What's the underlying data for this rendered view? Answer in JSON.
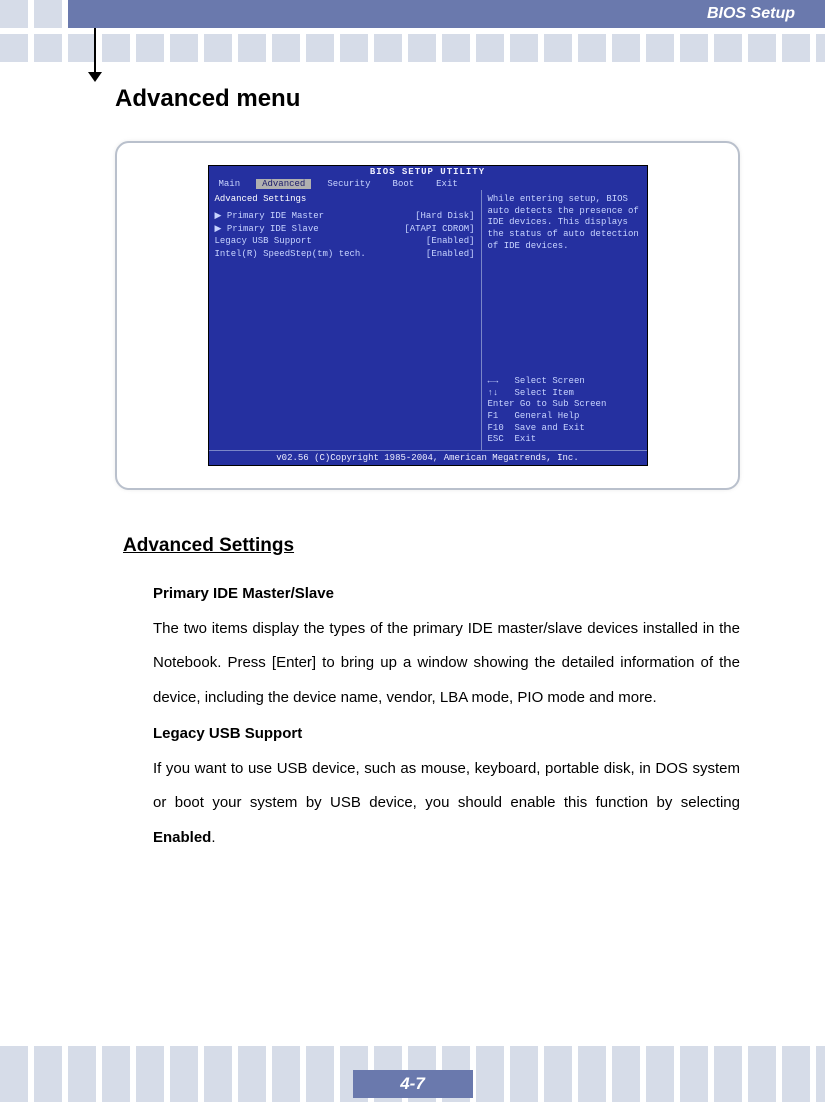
{
  "header": {
    "title_bar": "BIOS Setup"
  },
  "page": {
    "heading": "Advanced menu",
    "section_heading": "Advanced Settings",
    "page_number": "4-7"
  },
  "bios": {
    "utility_title": "BIOS SETUP UTILITY",
    "menu": [
      "Main",
      "Advanced",
      "Security",
      "Boot",
      "Exit"
    ],
    "selected_menu_index": 1,
    "panel_title": "Advanced Settings",
    "rows": [
      {
        "label": "▶ Primary IDE Master",
        "value": "[Hard Disk]"
      },
      {
        "label": "▶ Primary IDE Slave",
        "value": "[ATAPI CDROM]"
      },
      {
        "label": "Legacy USB Support",
        "value": "[Enabled]"
      },
      {
        "label": "Intel(R) SpeedStep(tm) tech.",
        "value": "[Enabled]"
      }
    ],
    "help_text": "While entering setup, BIOS auto detects the presence of IDE devices. This displays the status of auto detection of IDE devices.",
    "keys": [
      "←→   Select Screen",
      "↑↓   Select Item",
      "Enter Go to Sub Screen",
      "F1   General Help",
      "F10  Save and Exit",
      "ESC  Exit"
    ],
    "footer": "v02.56 (C)Copyright 1985-2004, American Megatrends, Inc."
  },
  "article": {
    "s1_title": "Primary IDE Master/Slave",
    "s1_body": "The two items display the types of the primary IDE master/slave devices installed in the Notebook.   Press [Enter] to bring up a window showing the detailed information of the device, including the device name, vendor, LBA mode, PIO mode and more.",
    "s2_title": "Legacy USB Support",
    "s2_body_pre": "If you want to use USB device, such as mouse, keyboard, portable disk, in DOS system or boot your system by USB device, you should enable this function by selecting ",
    "s2_body_bold": "Enabled",
    "s2_body_post": "."
  }
}
